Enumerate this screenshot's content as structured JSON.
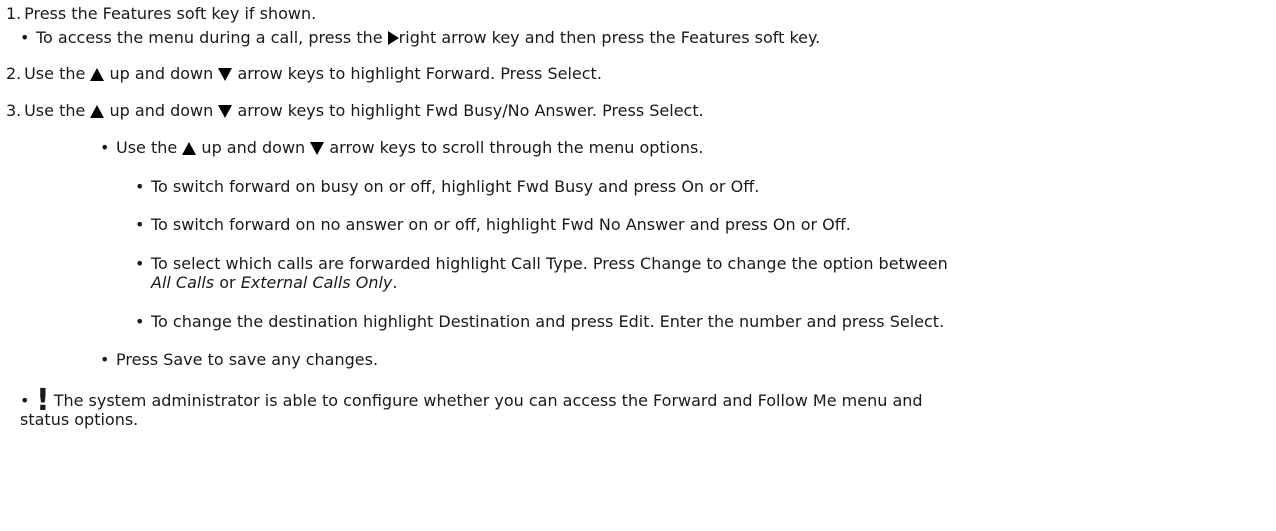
{
  "steps": [
    {
      "number": "1.",
      "text": "Press the Features soft key if shown.",
      "sub": {
        "before": "To access the menu during a call, press the",
        "icon": "right-arrow-key-icon",
        "after": "right arrow key and then press the Features soft key."
      }
    },
    {
      "number": "2.",
      "before": "Use the",
      "up_icon": "up-arrow-key-icon",
      "middle": "up and down",
      "down_icon": "down-arrow-key-icon",
      "after": "arrow keys to highlight Forward. Press Select."
    },
    {
      "number": "3.",
      "before": "Use the",
      "up_icon": "up-arrow-key-icon",
      "middle": "up and down",
      "down_icon": "down-arrow-key-icon",
      "after": "arrow keys to highlight Fwd Busy/No Answer. Press Select."
    }
  ],
  "scroll_bullet": {
    "before": "Use the",
    "middle": "up and down",
    "after": "arrow keys to scroll through the menu options."
  },
  "options": [
    "To switch forward on busy on or off, highlight Fwd Busy and press On or Off.",
    "To switch forward on no answer on or off, highlight Fwd No Answer and press On or Off."
  ],
  "call_type": {
    "line1": "To select which calls are forwarded highlight Call Type. Press Change to change the option between",
    "opt_a": "All Calls",
    "or": "or",
    "opt_b": "External Calls Only",
    "period": "."
  },
  "destination": "To change the destination highlight Destination and press Edit. Enter the number and press Select.",
  "save": "Press Save to save any changes.",
  "note": {
    "mark": "!",
    "line1": "The system administrator is able to configure whether you can access the Forward and Follow Me menu and",
    "line2": "status options."
  }
}
